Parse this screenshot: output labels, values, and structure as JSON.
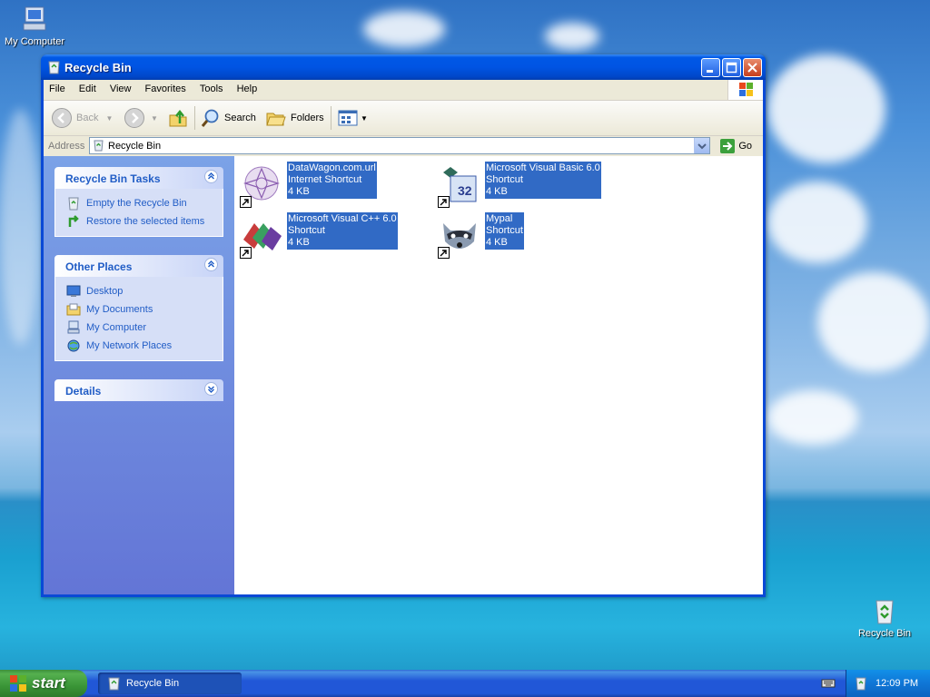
{
  "desktop": {
    "icons": [
      {
        "label": "My Computer",
        "icon": "my-computer-icon"
      },
      {
        "label": "Recycle Bin",
        "icon": "recycle-bin-icon"
      }
    ]
  },
  "window": {
    "title": "Recycle Bin",
    "menu": [
      "File",
      "Edit",
      "View",
      "Favorites",
      "Tools",
      "Help"
    ],
    "toolbar": {
      "back_label": "Back",
      "search_label": "Search",
      "folders_label": "Folders"
    },
    "address": {
      "label": "Address",
      "value": "Recycle Bin",
      "go_label": "Go"
    },
    "taskpane": {
      "tasks": {
        "title": "Recycle Bin Tasks",
        "items": [
          "Empty the Recycle Bin",
          "Restore the selected items"
        ]
      },
      "places": {
        "title": "Other Places",
        "items": [
          "Desktop",
          "My Documents",
          "My Computer",
          "My Network Places"
        ]
      },
      "details": {
        "title": "Details"
      }
    },
    "files": [
      {
        "name": "DataWagon.com.url",
        "type": "Internet Shortcut",
        "size": "4 KB"
      },
      {
        "name": "Microsoft Visual Basic 6.0",
        "type": "Shortcut",
        "size": "4 KB"
      },
      {
        "name": "Microsoft Visual C++ 6.0",
        "type": "Shortcut",
        "size": "4 KB"
      },
      {
        "name": "Mypal",
        "type": "Shortcut",
        "size": "4 KB"
      }
    ]
  },
  "taskbar": {
    "start_label": "start",
    "task_label": "Recycle Bin",
    "clock": "12:09 PM"
  },
  "colors": {
    "titlebar": "#0054e3",
    "selection": "#316ac5",
    "taskpane_link": "#215dc6",
    "start_green": "#3a9537"
  }
}
